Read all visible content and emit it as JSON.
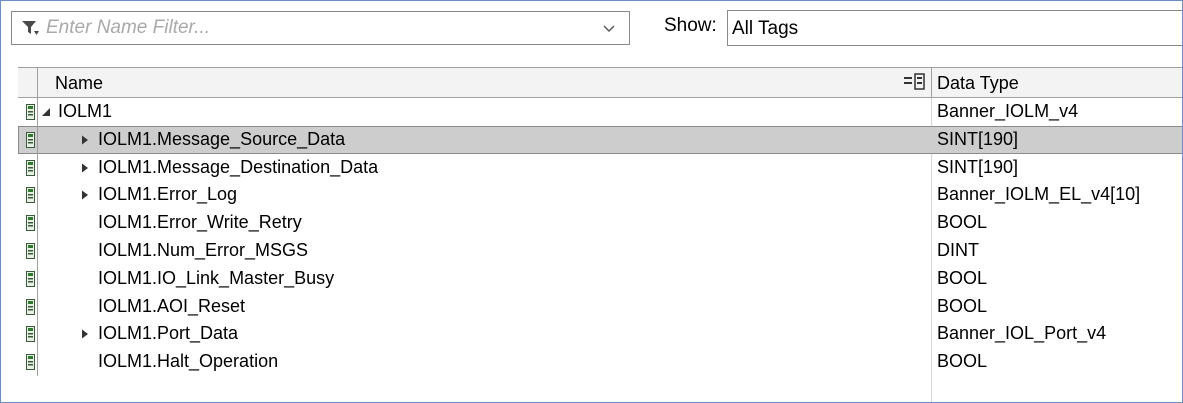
{
  "toolbar": {
    "filter_placeholder": "Enter Name Filter...",
    "show_label": "Show:",
    "show_value": "All Tags"
  },
  "columns": {
    "name": "Name",
    "data_type": "Data Type"
  },
  "rows": [
    {
      "name": "IOLM1",
      "data_type": "Banner_IOLM_v4",
      "expander": "expanded",
      "level": 0,
      "selected": false
    },
    {
      "name": "IOLM1.Message_Source_Data",
      "data_type": "SINT[190]",
      "expander": "collapsed",
      "level": 1,
      "selected": true
    },
    {
      "name": "IOLM1.Message_Destination_Data",
      "data_type": "SINT[190]",
      "expander": "collapsed",
      "level": 1,
      "selected": false
    },
    {
      "name": "IOLM1.Error_Log",
      "data_type": "Banner_IOLM_EL_v4[10]",
      "expander": "collapsed",
      "level": 1,
      "selected": false
    },
    {
      "name": "IOLM1.Error_Write_Retry",
      "data_type": "BOOL",
      "expander": "none",
      "level": 1,
      "selected": false
    },
    {
      "name": "IOLM1.Num_Error_MSGS",
      "data_type": "DINT",
      "expander": "none",
      "level": 1,
      "selected": false
    },
    {
      "name": "IOLM1.IO_Link_Master_Busy",
      "data_type": "BOOL",
      "expander": "none",
      "level": 1,
      "selected": false
    },
    {
      "name": "IOLM1.AOI_Reset",
      "data_type": "BOOL",
      "expander": "none",
      "level": 1,
      "selected": false
    },
    {
      "name": "IOLM1.Port_Data",
      "data_type": "Banner_IOL_Port_v4",
      "expander": "collapsed",
      "level": 1,
      "selected": false
    },
    {
      "name": "IOLM1.Halt_Operation",
      "data_type": "BOOL",
      "expander": "none",
      "level": 1,
      "selected": false
    }
  ],
  "icons": {
    "filter": "filter-icon",
    "dropdown": "chevron-down-icon",
    "column_config": "column-config-icon",
    "tag": "tag-icon",
    "expanded": "triangle-down-icon",
    "collapsed": "triangle-right-icon"
  }
}
